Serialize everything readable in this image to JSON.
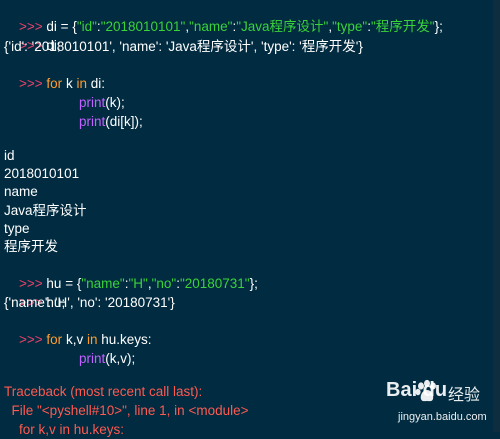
{
  "shell": {
    "prompt": ">>> ",
    "line1": {
      "code_a": "di = {",
      "s1": "\"id\"",
      "c1": ":",
      "s2": "\"2018010101\"",
      "c2": ",",
      "s3": "\"name\"",
      "c3": ":",
      "s4": "\"Java程序设计\"",
      "c4": ",",
      "s5": "\"type\"",
      "c5": ":",
      "s6": "\"程序开发\"",
      "code_b": "};"
    },
    "line2": "di;",
    "out_dict1": "{'id': '2018010101', 'name': 'Java程序设计', 'type': '程序开发'}",
    "for1": {
      "kw_for": "for",
      "var": " k ",
      "kw_in": "in",
      "rest": " di:"
    },
    "print1": {
      "fn": "print",
      "args": "(k);"
    },
    "print2": {
      "fn": "print",
      "args": "(di[k]);"
    },
    "output_lines": [
      "id",
      "2018010101",
      "name",
      "Java程序设计",
      "type",
      "程序开发"
    ],
    "line_hu": {
      "code_a": "hu = {",
      "s1": "\"name\"",
      "c1": ":",
      "s2": "\"H\"",
      "c2": ",",
      "s3": "\"no\"",
      "c3": ":",
      "s4": "\"20180731\"",
      "code_b": "};"
    },
    "line_hu2": "hu;",
    "out_dict2": "{'name': 'H', 'no': '20180731'}",
    "for2": {
      "kw_for": "for",
      "var": " k,v ",
      "kw_in": "in",
      "rest": " hu.keys:"
    },
    "print3": {
      "fn": "print",
      "args": "(k,v);"
    },
    "traceback": "Traceback (most recent call last):",
    "file_line": "  File \"<pyshell#10>\", line 1, in <module>",
    "cut_line": "    for k,v in hu.keys:"
  },
  "watermark": {
    "brand": "Bai du",
    "brand_cn": "经验",
    "url": "jingyan.baidu.com"
  },
  "colors": {
    "background": "#002b40",
    "prompt": "#f0406a",
    "keyword": "#ff9d2b",
    "builtin": "#c261ff",
    "string": "#3ad33a",
    "error": "#ff5a50"
  }
}
